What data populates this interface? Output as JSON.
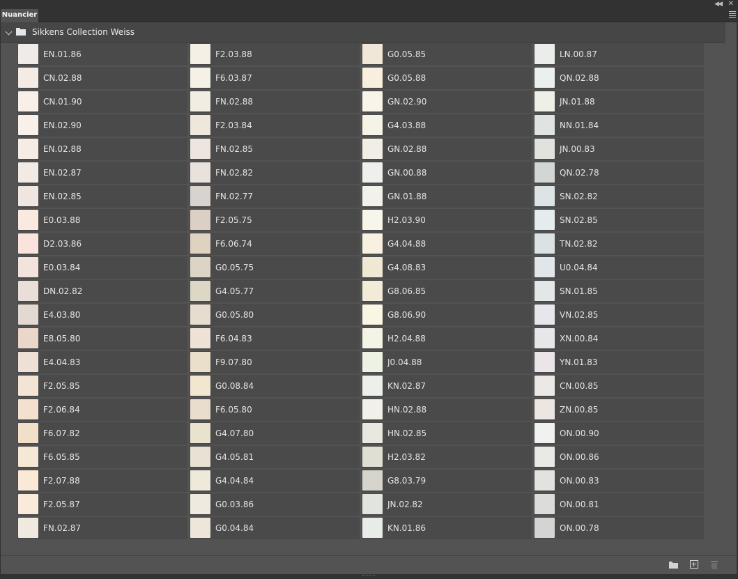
{
  "panel": {
    "tab_label": "Nuancier",
    "group_title": "Sikkens Collection Weiss"
  },
  "icons": {
    "collapse": "double-chevron-left-icon",
    "close": "close-icon",
    "menu": "hamburger-menu-icon",
    "group_folder": "folder-icon",
    "new_group": "folder-icon",
    "new_swatch": "add-swatch-icon",
    "delete": "trash-icon"
  },
  "swatches": [
    [
      {
        "name": "EN.01.86",
        "color": "#efebe8"
      },
      {
        "name": "CN.02.88",
        "color": "#f3ebe4"
      },
      {
        "name": "CN.01.90",
        "color": "#f7efe8"
      },
      {
        "name": "EN.02.90",
        "color": "#f8f0e9"
      },
      {
        "name": "EN.02.88",
        "color": "#f5ece5"
      },
      {
        "name": "EN.02.87",
        "color": "#f2eae4"
      },
      {
        "name": "EN.02.85",
        "color": "#efe6e1"
      },
      {
        "name": "E0.03.88",
        "color": "#f9e9df"
      },
      {
        "name": "D2.03.86",
        "color": "#f9e3dc"
      },
      {
        "name": "E0.03.84",
        "color": "#f2e3dc"
      },
      {
        "name": "DN.02.82",
        "color": "#e9ded8"
      },
      {
        "name": "E4.03.80",
        "color": "#e3d8d2"
      },
      {
        "name": "E8.05.80",
        "color": "#ead7c9"
      },
      {
        "name": "E4.04.83",
        "color": "#efe0d6"
      },
      {
        "name": "F2.05.85",
        "color": "#f4e4d5"
      },
      {
        "name": "F2.06.84",
        "color": "#f2e1cf"
      },
      {
        "name": "F6.07.82",
        "color": "#f2dfc7"
      },
      {
        "name": "F6.05.85",
        "color": "#f5e8d6"
      },
      {
        "name": "F2.07.88",
        "color": "#fbe9d8"
      },
      {
        "name": "F2.05.87",
        "color": "#faeadb"
      },
      {
        "name": "FN.02.87",
        "color": "#efe9e0"
      }
    ],
    [
      {
        "name": "F2.03.88",
        "color": "#f5f0e6"
      },
      {
        "name": "F6.03.87",
        "color": "#f6f1e6"
      },
      {
        "name": "FN.02.88",
        "color": "#f1ede3"
      },
      {
        "name": "F2.03.84",
        "color": "#efe6dc"
      },
      {
        "name": "FN.02.85",
        "color": "#ede6e0"
      },
      {
        "name": "FN.02.82",
        "color": "#e9e1dc"
      },
      {
        "name": "FN.02.77",
        "color": "#d8d3ce"
      },
      {
        "name": "F2.05.75",
        "color": "#dccfc4"
      },
      {
        "name": "F6.06.74",
        "color": "#dfd2c1"
      },
      {
        "name": "G0.05.75",
        "color": "#dcd5c6"
      },
      {
        "name": "G4.05.77",
        "color": "#ddd8c6"
      },
      {
        "name": "G0.05.80",
        "color": "#e6ddd0"
      },
      {
        "name": "F6.04.83",
        "color": "#eee2d6"
      },
      {
        "name": "F9.07.80",
        "color": "#eadfcb"
      },
      {
        "name": "G0.08.84",
        "color": "#f3e6cf"
      },
      {
        "name": "F6.05.80",
        "color": "#e9ddcd"
      },
      {
        "name": "G4.07.80",
        "color": "#e9e2cc"
      },
      {
        "name": "G4.05.81",
        "color": "#e7e2d3"
      },
      {
        "name": "G4.04.84",
        "color": "#eee9db"
      },
      {
        "name": "G0.03.86",
        "color": "#eeeae0"
      },
      {
        "name": "G0.04.84",
        "color": "#eee6da"
      }
    ],
    [
      {
        "name": "G0.05.85",
        "color": "#f0e7d8"
      },
      {
        "name": "G0.05.88",
        "color": "#f8efdf"
      },
      {
        "name": "GN.02.90",
        "color": "#f8f4ea"
      },
      {
        "name": "G4.03.88",
        "color": "#f5f2e6"
      },
      {
        "name": "GN.02.88",
        "color": "#f1efe5"
      },
      {
        "name": "GN.00.88",
        "color": "#eff0ec"
      },
      {
        "name": "GN.01.88",
        "color": "#f2f1ea"
      },
      {
        "name": "H2.03.90",
        "color": "#f8f6ea"
      },
      {
        "name": "G4.04.88",
        "color": "#f8f1e0"
      },
      {
        "name": "G4.08.83",
        "color": "#efe8d2"
      },
      {
        "name": "G8.06.85",
        "color": "#f1ebd8"
      },
      {
        "name": "G8.06.90",
        "color": "#fbf5e3"
      },
      {
        "name": "H2.04.88",
        "color": "#f3f4e5"
      },
      {
        "name": "J0.04.88",
        "color": "#eef2e4"
      },
      {
        "name": "KN.02.87",
        "color": "#edf0ea"
      },
      {
        "name": "HN.02.88",
        "color": "#f1f1e9"
      },
      {
        "name": "HN.02.85",
        "color": "#e8e8e0"
      },
      {
        "name": "H2.03.82",
        "color": "#e0dfd4"
      },
      {
        "name": "G8.03.79",
        "color": "#d7d5cb"
      },
      {
        "name": "JN.02.82",
        "color": "#e1e4df"
      },
      {
        "name": "KN.01.86",
        "color": "#e8ece6"
      }
    ],
    [
      {
        "name": "LN.00.87",
        "color": "#eaedea"
      },
      {
        "name": "QN.02.88",
        "color": "#eaf0ed"
      },
      {
        "name": "JN.01.88",
        "color": "#eeefe7"
      },
      {
        "name": "NN.01.84",
        "color": "#dfe4e2"
      },
      {
        "name": "JN.00.83",
        "color": "#e1e2de"
      },
      {
        "name": "QN.02.78",
        "color": "#d2d6d4"
      },
      {
        "name": "SN.02.82",
        "color": "#dde4e5"
      },
      {
        "name": "SN.02.85",
        "color": "#e4ecee"
      },
      {
        "name": "TN.02.82",
        "color": "#dbe2e4"
      },
      {
        "name": "U0.04.84",
        "color": "#e1e6ea"
      },
      {
        "name": "SN.01.85",
        "color": "#e3e7e8"
      },
      {
        "name": "VN.02.85",
        "color": "#e6e6ec"
      },
      {
        "name": "XN.00.84",
        "color": "#e7e6e8"
      },
      {
        "name": "YN.01.83",
        "color": "#ebe4e8"
      },
      {
        "name": "CN.00.85",
        "color": "#ece8e6"
      },
      {
        "name": "ZN.00.85",
        "color": "#ece6e2"
      },
      {
        "name": "ON.00.90",
        "color": "#f1f1ef"
      },
      {
        "name": "ON.00.86",
        "color": "#e9e9e6"
      },
      {
        "name": "ON.00.83",
        "color": "#e2e2df"
      },
      {
        "name": "ON.00.81",
        "color": "#dcdcda"
      },
      {
        "name": "ON.00.78",
        "color": "#d4d4d2"
      }
    ]
  ]
}
